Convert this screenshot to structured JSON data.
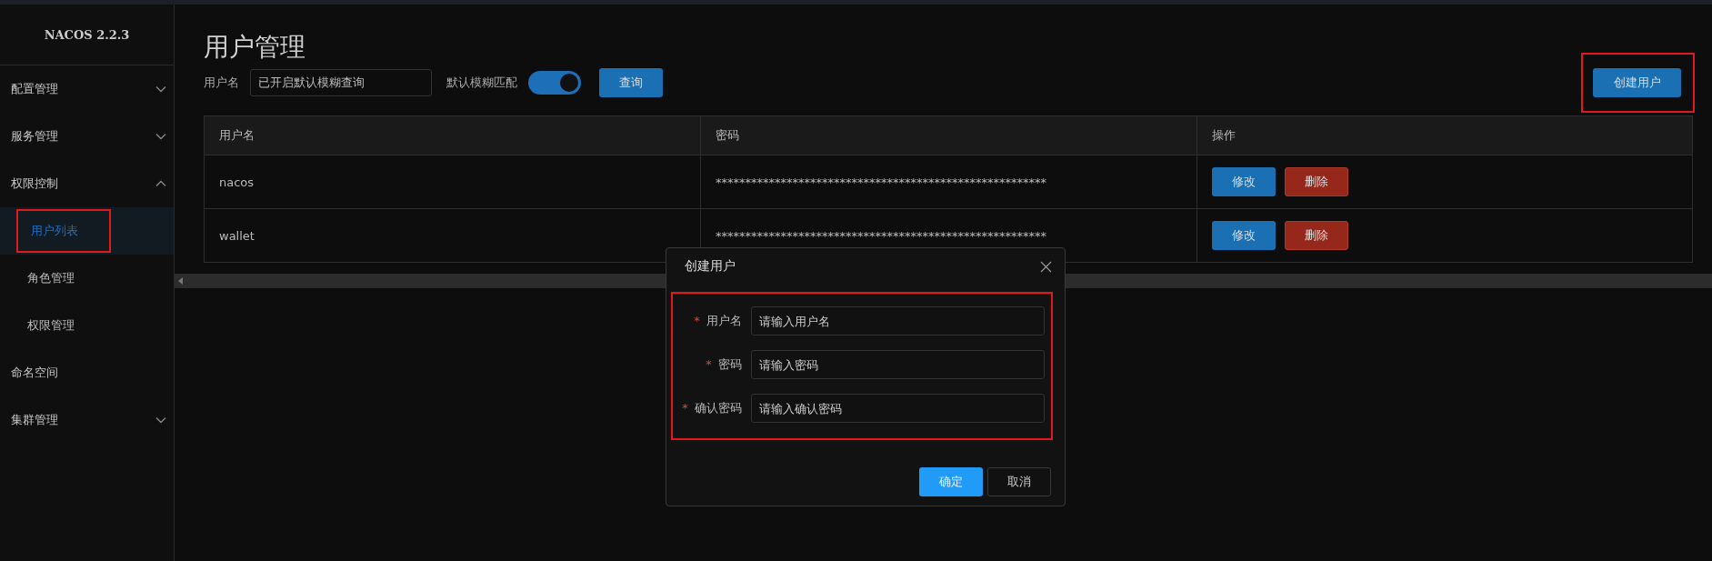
{
  "sidebar": {
    "logo": "NACOS 2.2.3",
    "items": [
      {
        "label": "配置管理",
        "expanded": false
      },
      {
        "label": "服务管理",
        "expanded": false
      },
      {
        "label": "权限控制",
        "expanded": true,
        "children": [
          {
            "label": "用户列表",
            "selected": true,
            "highlighted": true
          },
          {
            "label": "角色管理",
            "selected": false,
            "highlighted": false
          },
          {
            "label": "权限管理",
            "selected": false,
            "highlighted": false
          }
        ]
      },
      {
        "label": "命名空间"
      },
      {
        "label": "集群管理",
        "expanded": false
      }
    ]
  },
  "page": {
    "title": "用户管理",
    "filter_label": "用户名",
    "filter_value": "已开启默认模糊查询",
    "fuzzy_label": "默认模糊匹配",
    "fuzzy_on": true,
    "query_button": "查询",
    "create_button": "创建用户",
    "create_highlighted": true
  },
  "table": {
    "columns": [
      "用户名",
      "密码",
      "操作"
    ],
    "rows": [
      {
        "username": "nacos",
        "password": "********************************************************",
        "actions": [
          "修改",
          "删除"
        ]
      },
      {
        "username": "wallet",
        "password": "********************************************************",
        "actions": [
          "修改",
          "删除"
        ]
      }
    ]
  },
  "dialog": {
    "title": "创建用户",
    "form_highlighted": true,
    "fields": [
      {
        "label": "用户名",
        "required_mark": "*",
        "placeholder": "请输入用户名"
      },
      {
        "label": "密码",
        "required_mark": "*",
        "placeholder": "请输入密码"
      },
      {
        "label": "确认密码",
        "required_mark": "*",
        "placeholder": "请输入确认密码"
      }
    ],
    "buttons": [
      {
        "label": "确定",
        "kind": "primary"
      },
      {
        "label": "取消",
        "kind": "secondary"
      }
    ]
  }
}
